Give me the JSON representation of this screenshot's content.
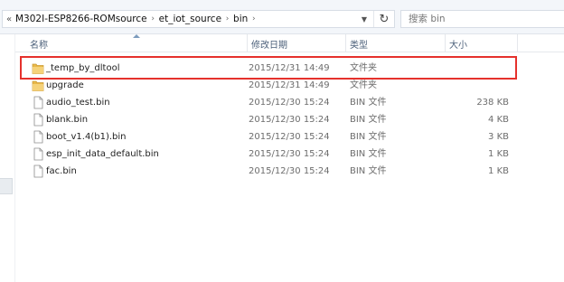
{
  "address_bar": {
    "overflow": "«",
    "breadcrumbs": [
      "M302I-ESP8266-ROMsource",
      "et_iot_source",
      "bin"
    ],
    "separator": "›"
  },
  "search": {
    "placeholder": "搜索 bin"
  },
  "columns": {
    "name": "名称",
    "date_modified": "修改日期",
    "type": "类型",
    "size": "大小"
  },
  "files": [
    {
      "name": "_temp_by_dltool",
      "date": "2015/12/31 14:49",
      "type": "文件夹",
      "size": "",
      "icon": "folder-icon"
    },
    {
      "name": "upgrade",
      "date": "2015/12/31 14:49",
      "type": "文件夹",
      "size": "",
      "icon": "folder-icon"
    },
    {
      "name": "audio_test.bin",
      "date": "2015/12/30 15:24",
      "type": "BIN 文件",
      "size": "238 KB",
      "icon": "file-icon"
    },
    {
      "name": "blank.bin",
      "date": "2015/12/30 15:24",
      "type": "BIN 文件",
      "size": "4 KB",
      "icon": "file-icon"
    },
    {
      "name": "boot_v1.4(b1).bin",
      "date": "2015/12/30 15:24",
      "type": "BIN 文件",
      "size": "3 KB",
      "icon": "file-icon"
    },
    {
      "name": "esp_init_data_default.bin",
      "date": "2015/12/30 15:24",
      "type": "BIN 文件",
      "size": "1 KB",
      "icon": "file-icon"
    },
    {
      "name": "fac.bin",
      "date": "2015/12/30 15:24",
      "type": "BIN 文件",
      "size": "1 KB",
      "icon": "file-icon"
    }
  ],
  "highlight": {
    "row_index": 0,
    "color": "#e5312c"
  },
  "colors": {
    "folder": "#e8b84a",
    "header_text": "#4c607a",
    "meta_text": "#6d6d6d"
  }
}
